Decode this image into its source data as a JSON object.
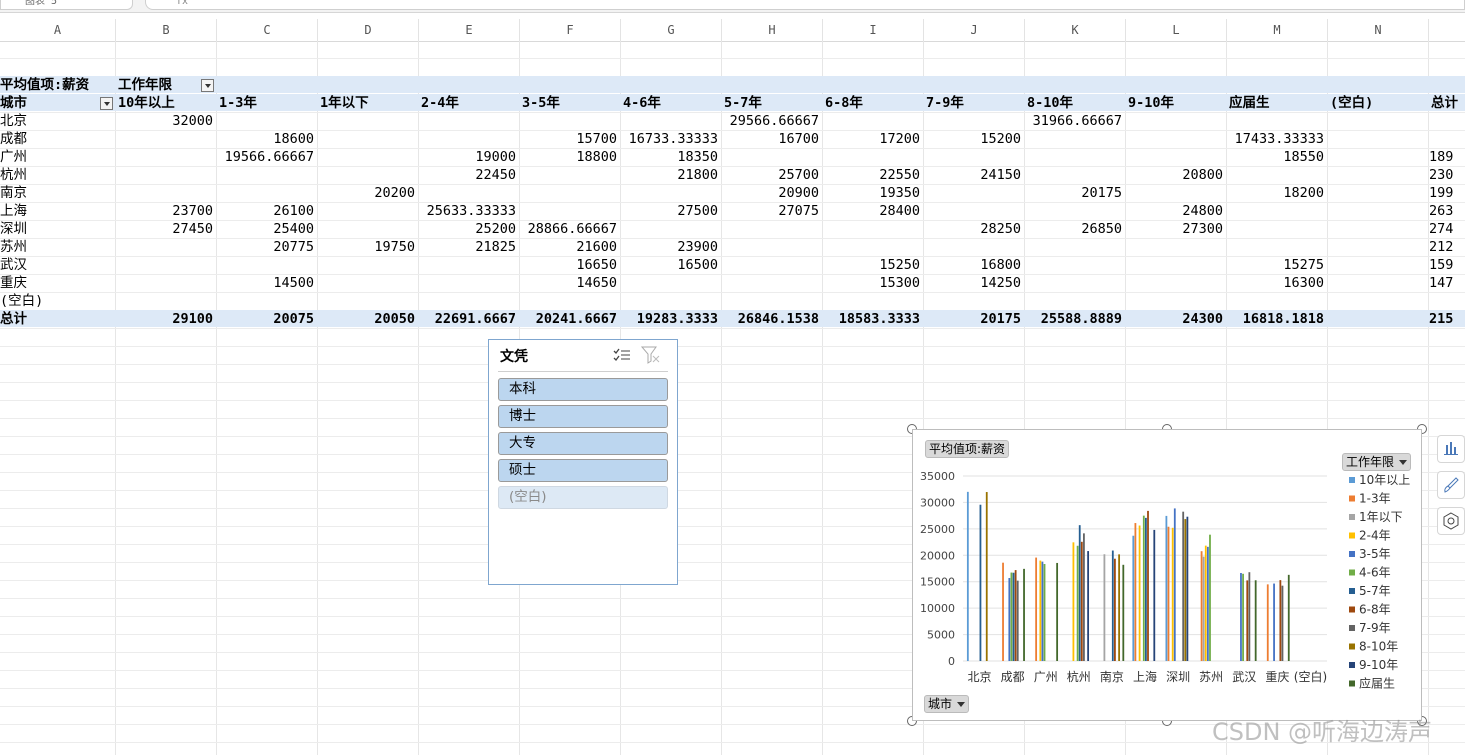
{
  "formula_bar": {
    "name_box": "图表 5",
    "fx_placeholder": "fx"
  },
  "columns": [
    "A",
    "B",
    "C",
    "D",
    "E",
    "F",
    "G",
    "H",
    "I",
    "J",
    "K",
    "L",
    "M",
    "N"
  ],
  "pivot": {
    "value_field": "平均值项:薪资",
    "col_field": "工作年限",
    "row_field": "城市",
    "col_labels": [
      "10年以上",
      "1-3年",
      "1年以下",
      "2-4年",
      "3-5年",
      "4-6年",
      "5-7年",
      "6-8年",
      "7-9年",
      "8-10年",
      "9-10年",
      "应届生",
      "(空白)",
      "总计"
    ],
    "rows": [
      {
        "city": "北京",
        "v": [
          "32000",
          "",
          "",
          "",
          "",
          "",
          "29566.66667",
          "",
          "",
          "31966.66667",
          "",
          "",
          "",
          ""
        ]
      },
      {
        "city": "成都",
        "v": [
          "",
          "18600",
          "",
          "",
          "15700",
          "16733.33333",
          "16700",
          "17200",
          "15200",
          "",
          "",
          "17433.33333",
          "",
          ""
        ]
      },
      {
        "city": "广州",
        "v": [
          "",
          "19566.66667",
          "",
          "19000",
          "18800",
          "18350",
          "",
          "",
          "",
          "",
          "",
          "18550",
          "",
          "189"
        ]
      },
      {
        "city": "杭州",
        "v": [
          "",
          "",
          "",
          "22450",
          "",
          "21800",
          "25700",
          "22550",
          "24150",
          "",
          "20800",
          "",
          "",
          "230"
        ]
      },
      {
        "city": "南京",
        "v": [
          "",
          "",
          "20200",
          "",
          "",
          "",
          "20900",
          "19350",
          "",
          "20175",
          "",
          "18200",
          "",
          "199"
        ]
      },
      {
        "city": "上海",
        "v": [
          "23700",
          "26100",
          "",
          "25633.33333",
          "",
          "27500",
          "27075",
          "28400",
          "",
          "",
          "24800",
          "",
          "",
          "263"
        ]
      },
      {
        "city": "深圳",
        "v": [
          "27450",
          "25400",
          "",
          "25200",
          "28866.66667",
          "",
          "",
          "",
          "28250",
          "26850",
          "27300",
          "",
          "",
          "274"
        ]
      },
      {
        "city": "苏州",
        "v": [
          "",
          "20775",
          "19750",
          "21825",
          "21600",
          "23900",
          "",
          "",
          "",
          "",
          "",
          "",
          "",
          "212"
        ]
      },
      {
        "city": "武汉",
        "v": [
          "",
          "",
          "",
          "",
          "16650",
          "16500",
          "",
          "15250",
          "16800",
          "",
          "",
          "15275",
          "",
          "159"
        ]
      },
      {
        "city": "重庆",
        "v": [
          "",
          "14500",
          "",
          "",
          "14650",
          "",
          "",
          "15300",
          "14250",
          "",
          "",
          "16300",
          "",
          "147"
        ]
      },
      {
        "city": "(空白)",
        "v": [
          "",
          "",
          "",
          "",
          "",
          "",
          "",
          "",
          "",
          "",
          "",
          "",
          "",
          ""
        ]
      }
    ],
    "total_label": "总计",
    "totals": [
      "29100",
      "20075",
      "20050",
      "22691.6667",
      "20241.6667",
      "19283.3333",
      "26846.1538",
      "18583.3333",
      "20175",
      "25588.8889",
      "24300",
      "16818.1818",
      "",
      "215"
    ]
  },
  "slicer": {
    "title": "文凭",
    "items": [
      "本科",
      "博士",
      "大专",
      "硕士",
      "(空白)"
    ]
  },
  "chart_data": {
    "type": "bar",
    "title": "",
    "value_button": "平均值项:薪资",
    "legend_button": "工作年限",
    "axis_button": "城市",
    "legend_position": "right",
    "ylim": [
      0,
      35000
    ],
    "yticks": [
      "35000",
      "30000",
      "25000",
      "20000",
      "15000",
      "10000",
      "5000",
      "0"
    ],
    "categories": [
      "北京",
      "成都",
      "广州",
      "杭州",
      "南京",
      "上海",
      "深圳",
      "苏州",
      "武汉",
      "重庆",
      "(空白)"
    ],
    "series": [
      {
        "name": "10年以上",
        "color": "#5b9bd5",
        "values": [
          32000,
          null,
          null,
          null,
          null,
          23700,
          27450,
          null,
          null,
          null,
          null
        ]
      },
      {
        "name": "1-3年",
        "color": "#ed7d31",
        "values": [
          null,
          18600,
          19566.67,
          null,
          null,
          26100,
          25400,
          20775,
          null,
          14500,
          null
        ]
      },
      {
        "name": "1年以下",
        "color": "#a5a5a5",
        "values": [
          null,
          null,
          null,
          null,
          20200,
          null,
          null,
          19750,
          null,
          null,
          null
        ]
      },
      {
        "name": "2-4年",
        "color": "#ffc000",
        "values": [
          null,
          null,
          19000,
          22450,
          null,
          25633.33,
          25200,
          21825,
          null,
          null,
          null
        ]
      },
      {
        "name": "3-5年",
        "color": "#4472c4",
        "values": [
          null,
          15700,
          18800,
          null,
          null,
          null,
          28866.67,
          21600,
          16650,
          14650,
          null
        ]
      },
      {
        "name": "4-6年",
        "color": "#70ad47",
        "values": [
          null,
          16733.33,
          18350,
          21800,
          null,
          27500,
          null,
          23900,
          16500,
          null,
          null
        ]
      },
      {
        "name": "5-7年",
        "color": "#255e91",
        "values": [
          29566.67,
          16700,
          null,
          25700,
          20900,
          27075,
          null,
          null,
          null,
          null,
          null
        ]
      },
      {
        "name": "6-8年",
        "color": "#9e480e",
        "values": [
          null,
          17200,
          null,
          22550,
          19350,
          28400,
          null,
          null,
          15250,
          15300,
          null
        ]
      },
      {
        "name": "7-9年",
        "color": "#636363",
        "values": [
          null,
          15200,
          null,
          24150,
          null,
          null,
          28250,
          null,
          16800,
          14250,
          null
        ]
      },
      {
        "name": "8-10年",
        "color": "#997300",
        "values": [
          31966.67,
          null,
          null,
          null,
          20175,
          null,
          26850,
          null,
          null,
          null,
          null
        ]
      },
      {
        "name": "9-10年",
        "color": "#264478",
        "values": [
          null,
          null,
          null,
          20800,
          null,
          24800,
          27300,
          null,
          null,
          null,
          null
        ]
      },
      {
        "name": "应届生",
        "color": "#43682b",
        "values": [
          null,
          17433.33,
          18550,
          null,
          18200,
          null,
          null,
          null,
          15275,
          16300,
          null
        ]
      }
    ]
  },
  "watermark": "CSDN @听海边涛声"
}
